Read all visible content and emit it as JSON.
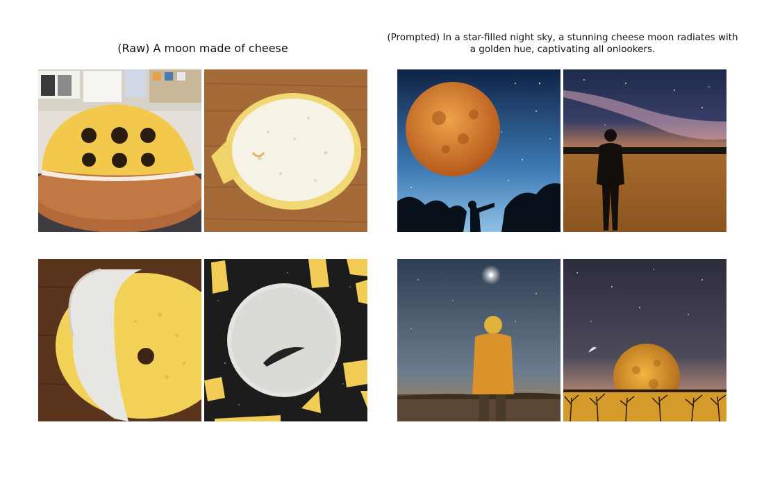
{
  "panels": {
    "raw": {
      "title": "(Raw) A moon made of cheese",
      "images": [
        "cheese-dome-with-holes-on-wooden-board",
        "round-cheese-slice-on-wooden-table",
        "cheese-wheel-with-white-rind-on-wood",
        "white-cratered-cheese-disc-on-dark-surface"
      ]
    },
    "prompted": {
      "title": "(Prompted) In a star-filled night sky, a stunning cheese moon radiates with a golden hue, captivating all onlookers.",
      "images": [
        "orange-moon-in-starry-sky-with-silhouette",
        "silhouette-man-under-milky-way-desert",
        "person-in-yellow-coat-looking-at-starry-sky",
        "golden-moon-rising-over-trees"
      ]
    }
  },
  "colors": {
    "cheese": "#f2c94c",
    "wood": "#9a6232",
    "night_sky": "#1a2d52",
    "golden_moon": "#d9862a"
  }
}
